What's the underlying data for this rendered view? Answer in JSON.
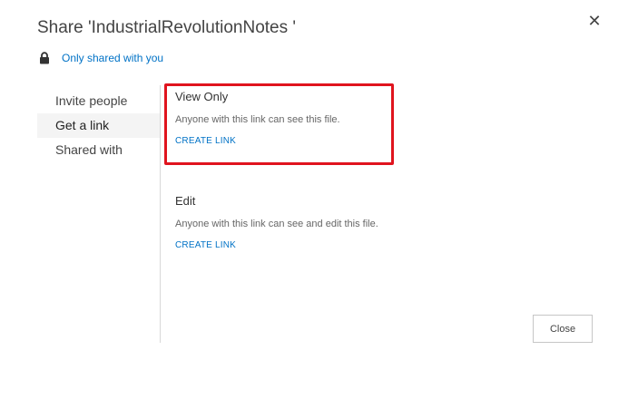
{
  "dialog": {
    "title": "Share 'IndustrialRevolutionNotes '",
    "close_icon": "close-icon"
  },
  "permission": {
    "icon": "lock-icon",
    "label": "Only shared with you"
  },
  "nav": {
    "items": [
      {
        "label": "Invite people",
        "active": false
      },
      {
        "label": "Get a link",
        "active": true
      },
      {
        "label": "Shared with",
        "active": false
      }
    ]
  },
  "options": {
    "view_only": {
      "title": "View Only",
      "description": "Anyone with this link can see this file.",
      "link_label": "CREATE LINK",
      "highlighted": true
    },
    "edit": {
      "title": "Edit",
      "description": "Anyone with this link can see and edit this file.",
      "link_label": "CREATE LINK"
    }
  },
  "footer": {
    "close_label": "Close"
  },
  "colors": {
    "link": "#0072c6",
    "highlight": "#e0141e",
    "active_nav_bg": "#f4f4f4"
  }
}
